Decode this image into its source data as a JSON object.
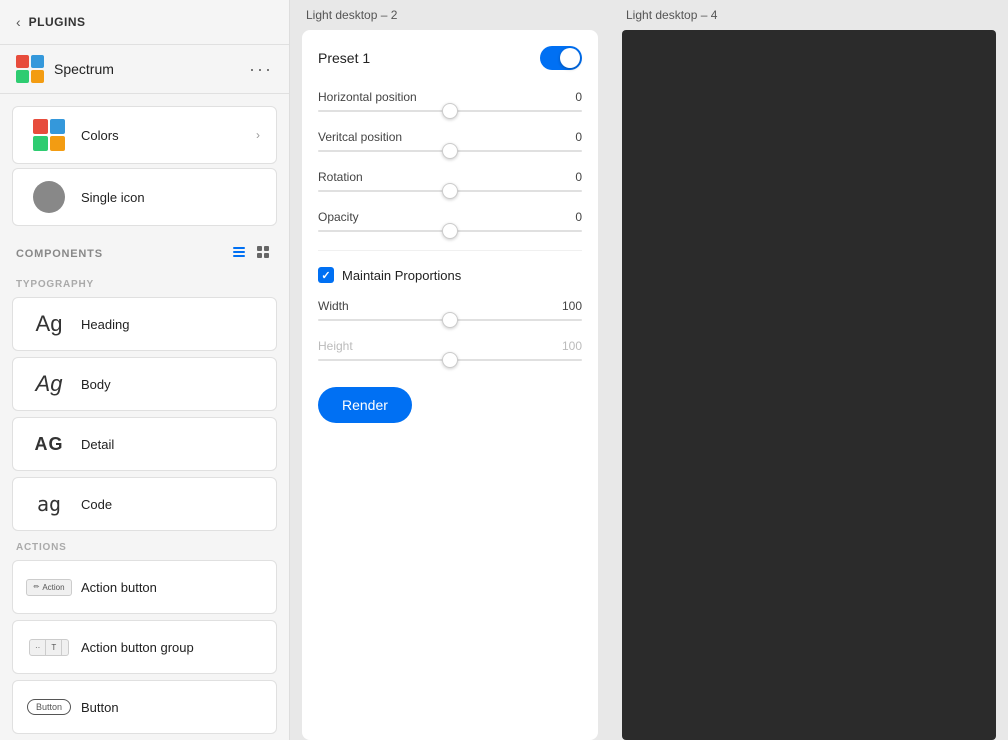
{
  "sidebar": {
    "back_label": "PLUGINS",
    "spectrum": {
      "name": "Spectrum",
      "colors": [
        "#e74c3c",
        "#3498db",
        "#2ecc71",
        "#f39c12"
      ]
    },
    "components_label": "Components",
    "sections": {
      "typography": {
        "title": "TYPOGRAPHY",
        "items": [
          {
            "label": "Heading",
            "preview": "Ag",
            "style": "heading"
          },
          {
            "label": "Body",
            "preview": "Ag",
            "style": "body"
          },
          {
            "label": "Detail",
            "preview": "AG",
            "style": "detail"
          },
          {
            "label": "Code",
            "preview": "ag",
            "style": "code"
          }
        ]
      },
      "actions": {
        "title": "ACTIONS",
        "items": [
          {
            "label": "Action button",
            "type": "action-btn"
          },
          {
            "label": "Action button group",
            "type": "action-btn-group"
          },
          {
            "label": "Button",
            "type": "button"
          }
        ]
      }
    }
  },
  "center": {
    "tab_label": "Light desktop – 2",
    "card": {
      "preset_label": "Preset 1",
      "preset_enabled": true,
      "sliders": [
        {
          "label": "Horizontal position",
          "value": "0",
          "thumb_pos": "50"
        },
        {
          "label": "Veritcal position",
          "value": "0",
          "thumb_pos": "50"
        },
        {
          "label": "Rotation",
          "value": "0",
          "thumb_pos": "50"
        },
        {
          "label": "Opacity",
          "value": "0",
          "thumb_pos": "50"
        }
      ],
      "maintain_proportions": {
        "label": "Maintain Proportions",
        "checked": true
      },
      "width_slider": {
        "label": "Width",
        "value": "100",
        "thumb_pos": "50"
      },
      "height_slider": {
        "label": "Height",
        "value": "100",
        "thumb_pos": "50"
      },
      "render_btn": "Render"
    }
  },
  "right": {
    "tab_label": "Light desktop – 4"
  },
  "colors": {
    "label": "Colors",
    "has_arrow": true,
    "swatches": [
      "#e74c3c",
      "#3498db",
      "#2ecc71",
      "#f39c12"
    ]
  },
  "single_icon": {
    "label": "Single icon"
  }
}
